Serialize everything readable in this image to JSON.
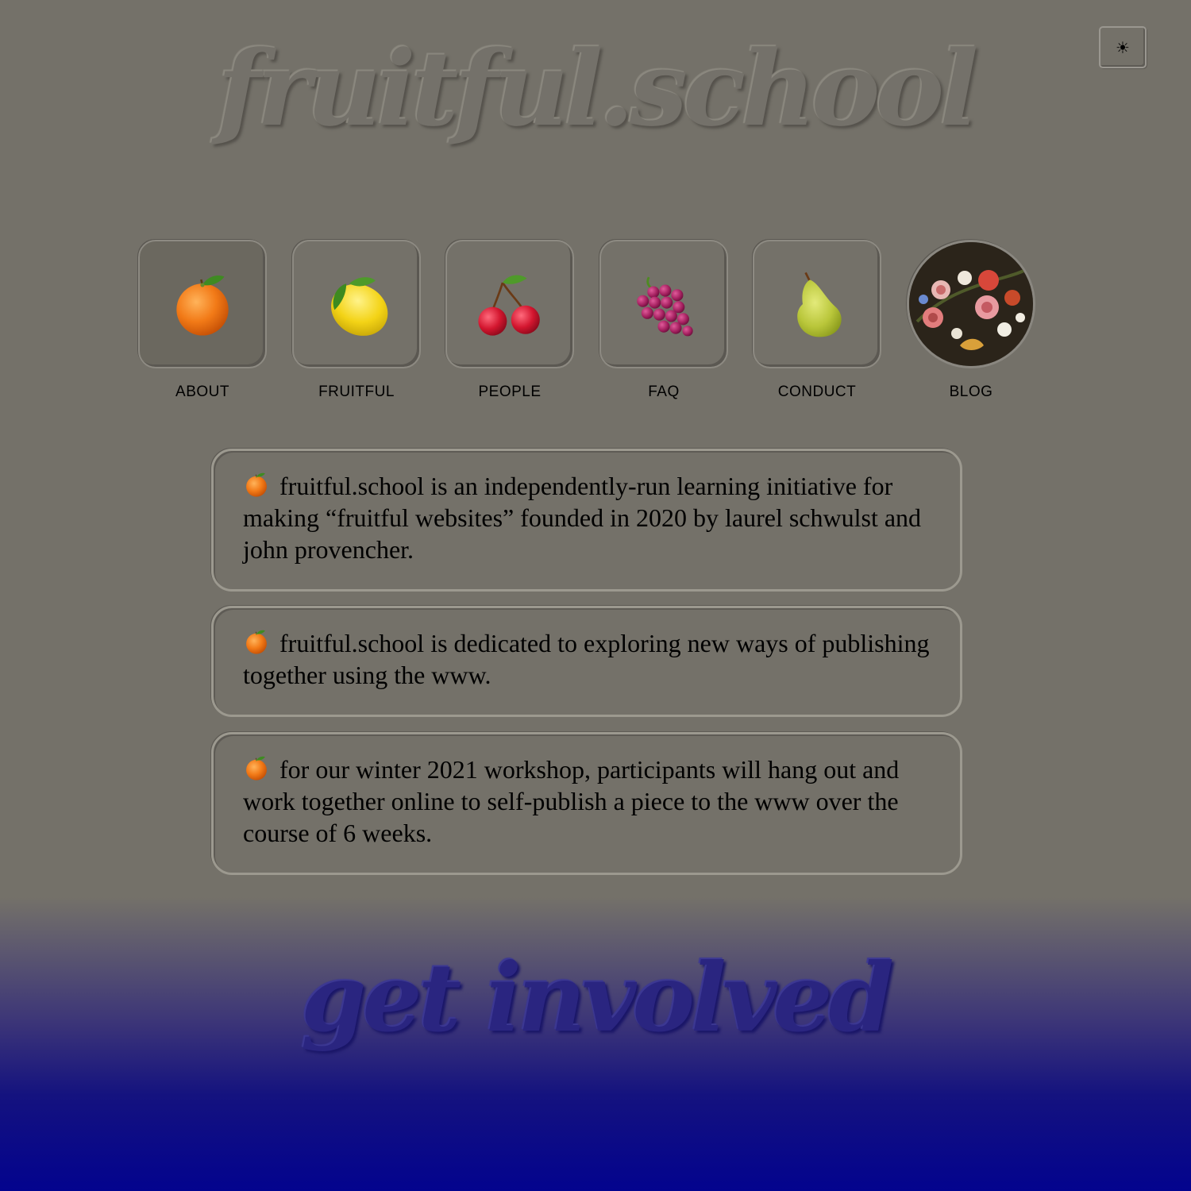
{
  "header": {
    "site_title": "fruitful.school",
    "theme_toggle_icon": "sun-icon",
    "theme_toggle_glyph": "☀"
  },
  "nav": {
    "items": [
      {
        "label": "ABOUT",
        "icon": "orange-icon",
        "active": true
      },
      {
        "label": "FRUITFUL",
        "icon": "lemon-icon",
        "active": false
      },
      {
        "label": "PEOPLE",
        "icon": "cherries-icon",
        "active": false
      },
      {
        "label": "FAQ",
        "icon": "grapes-icon",
        "active": false
      },
      {
        "label": "CONDUCT",
        "icon": "pear-icon",
        "active": false
      },
      {
        "label": "BLOG",
        "icon": "flower-painting-image",
        "active": false
      }
    ]
  },
  "about": {
    "bullet_icon": "orange-icon",
    "paragraphs": [
      "fruitful.school is an independently-run learning initiative for making “fruitful websites” founded in 2020 by laurel schwulst and john provencher.",
      "fruitful.school is dedicated to exploring new ways of publishing together using the www.",
      "for our winter 2021 workshop, participants will hang out and work together online to self-publish a piece to the www over the course of 6 weeks."
    ]
  },
  "footer": {
    "heading": "get involved"
  },
  "colors": {
    "page_background": "#747169",
    "gradient_bottom": "#03038e",
    "card_border": "#9c998f",
    "text": "#000000"
  }
}
